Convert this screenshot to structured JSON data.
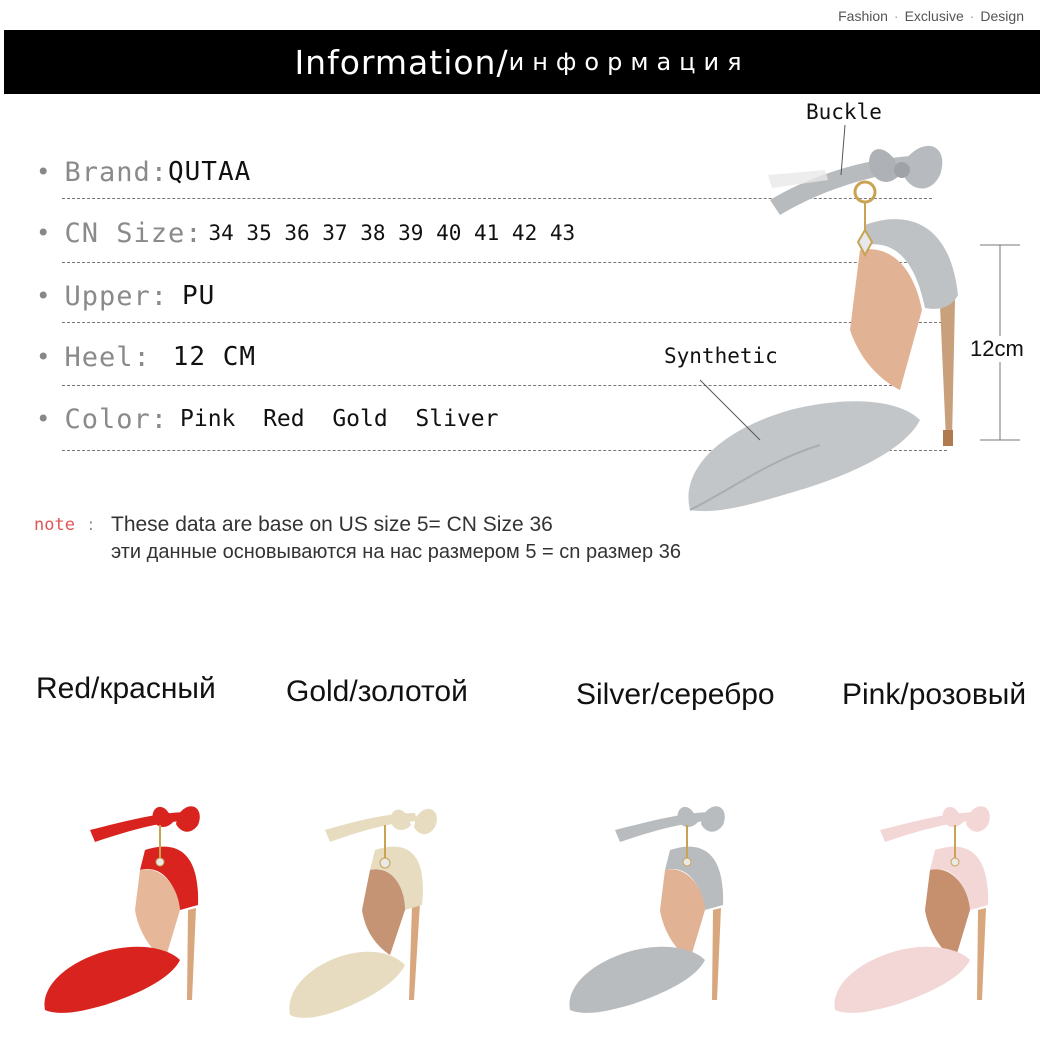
{
  "header": {
    "tagline": [
      "Fashion",
      "Exclusive",
      "Design"
    ],
    "title_en": "Information/",
    "title_ru": "информация"
  },
  "specs": [
    {
      "label": "Brand:",
      "value": "QUTAA"
    },
    {
      "label": "CN Size:",
      "value": "34 35 36 37 38 39 40 41 42 43"
    },
    {
      "label": "Upper:",
      "value": "PU"
    },
    {
      "label": "Heel:",
      "value": "12 CM"
    },
    {
      "label": "Color:",
      "value": "Pink  Red  Gold  Sliver"
    }
  ],
  "note": {
    "label": "note",
    "line1": "These data are base on US size 5= CN Size 36",
    "line2": "эти данные основываются на нас размером 5 = cn размер 36"
  },
  "annotations": {
    "buckle": "Buckle",
    "synthetic": "Synthetic",
    "height": "12cm"
  },
  "variants": [
    {
      "name": "Red/красный",
      "color": "#d9231f"
    },
    {
      "name": "Gold/золотой",
      "color": "#e7dcbf"
    },
    {
      "name": "Silver/серебро",
      "color": "#b9bcbf"
    },
    {
      "name": "Pink/розовый",
      "color": "#f2d7d6"
    }
  ]
}
